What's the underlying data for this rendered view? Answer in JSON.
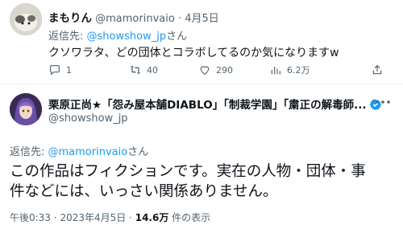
{
  "reply_tweet": {
    "display_name": "まもりん",
    "handle": "@mamorinvaio",
    "separator": "·",
    "date": "4月5日",
    "reply_prefix": "返信先: ",
    "reply_target": "@showshow_jp",
    "reply_suffix": "さん",
    "text": "クソワラタ、どの団体とコラボしてるのか気になりますw",
    "actions": {
      "reply_count": "1",
      "retweet_count": "40",
      "like_count": "290",
      "view_count": "6.2万"
    }
  },
  "main_tweet": {
    "display_name": "栗原正尚★「怨み屋本舗DIABLO」「制裁学園」「粛正の解毒師...",
    "handle": "@showshow_jp",
    "reply_prefix": "返信先: ",
    "reply_target": "@mamorinvaio",
    "reply_suffix": "さん",
    "text_line1": "この作品はフィクションです。実在の人物・団体・事",
    "text_line2": "件などには、いっさい関係ありません。",
    "time": "午後0:33",
    "date": "2023年4月5日",
    "views": "14.6万",
    "views_suffix": "件の表示"
  },
  "colors": {
    "text": "#0f1419",
    "muted": "#536471",
    "link": "#1d9bf0",
    "verified": "#1d9bf0"
  }
}
